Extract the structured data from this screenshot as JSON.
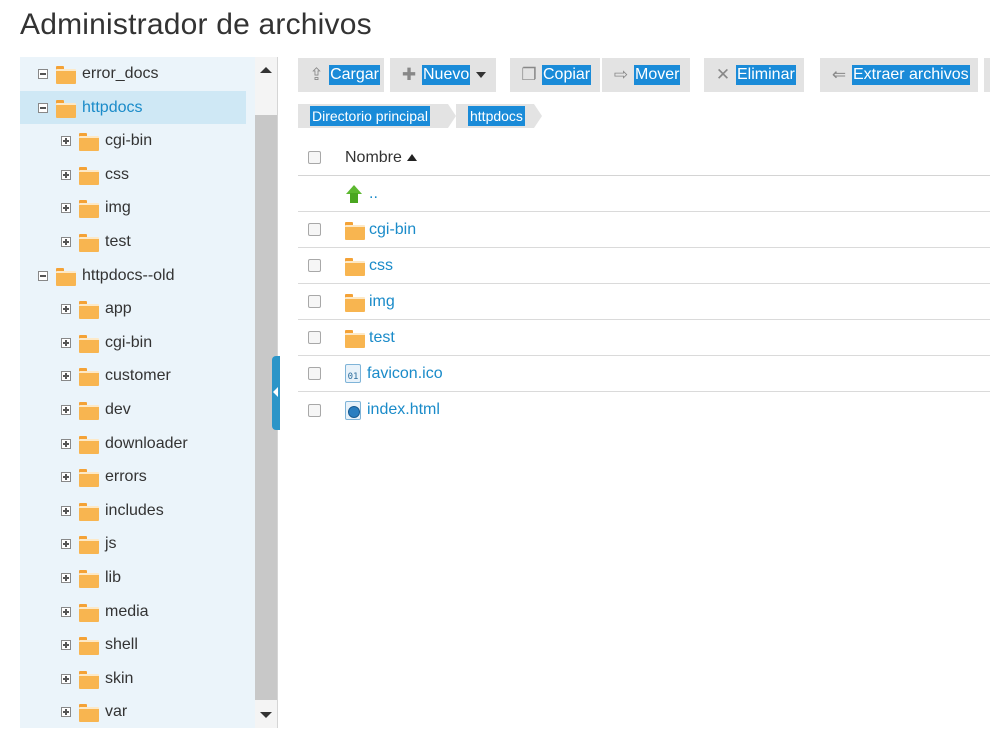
{
  "page": {
    "title": "Administrador de archivos"
  },
  "tree": [
    {
      "label": "error_docs",
      "state": "minus",
      "level": 0
    },
    {
      "label": "httpdocs",
      "state": "minus",
      "level": 0,
      "selected": true
    },
    {
      "label": "cgi-bin",
      "state": "plus",
      "level": 1
    },
    {
      "label": "css",
      "state": "plus",
      "level": 1
    },
    {
      "label": "img",
      "state": "plus",
      "level": 1
    },
    {
      "label": "test",
      "state": "plus",
      "level": 1
    },
    {
      "label": "httpdocs--old",
      "state": "minus",
      "level": 0
    },
    {
      "label": "app",
      "state": "plus",
      "level": 1
    },
    {
      "label": "cgi-bin",
      "state": "plus",
      "level": 1
    },
    {
      "label": "customer",
      "state": "plus",
      "level": 1
    },
    {
      "label": "dev",
      "state": "plus",
      "level": 1
    },
    {
      "label": "downloader",
      "state": "plus",
      "level": 1
    },
    {
      "label": "errors",
      "state": "plus",
      "level": 1
    },
    {
      "label": "includes",
      "state": "plus",
      "level": 1
    },
    {
      "label": "js",
      "state": "plus",
      "level": 1
    },
    {
      "label": "lib",
      "state": "plus",
      "level": 1
    },
    {
      "label": "media",
      "state": "plus",
      "level": 1
    },
    {
      "label": "shell",
      "state": "plus",
      "level": 1
    },
    {
      "label": "skin",
      "state": "plus",
      "level": 1
    },
    {
      "label": "var",
      "state": "plus",
      "level": 1
    }
  ],
  "toolbar": {
    "upload_label": "Cargar",
    "new_label": "Nuevo",
    "copy_label": "Copiar",
    "move_label": "Mover",
    "delete_label": "Eliminar",
    "extract_label": "Extraer archivos"
  },
  "breadcrumb": {
    "root_label": "Directorio principal",
    "current_label": "httpdocs"
  },
  "list": {
    "name_header": "Nombre",
    "parent_label": "..",
    "items": [
      {
        "name": "cgi-bin",
        "type": "folder"
      },
      {
        "name": "css",
        "type": "folder"
      },
      {
        "name": "img",
        "type": "folder"
      },
      {
        "name": "test",
        "type": "folder"
      },
      {
        "name": "favicon.ico",
        "type": "ico",
        "icon_text": "01"
      },
      {
        "name": "index.html",
        "type": "html"
      }
    ]
  },
  "colors": {
    "accent": "#1a8bd8",
    "link": "#1a8bc9",
    "sidebar_bg": "#ebf4fa",
    "selected_bg": "#cfe8f5",
    "folder": "#f8b550"
  }
}
